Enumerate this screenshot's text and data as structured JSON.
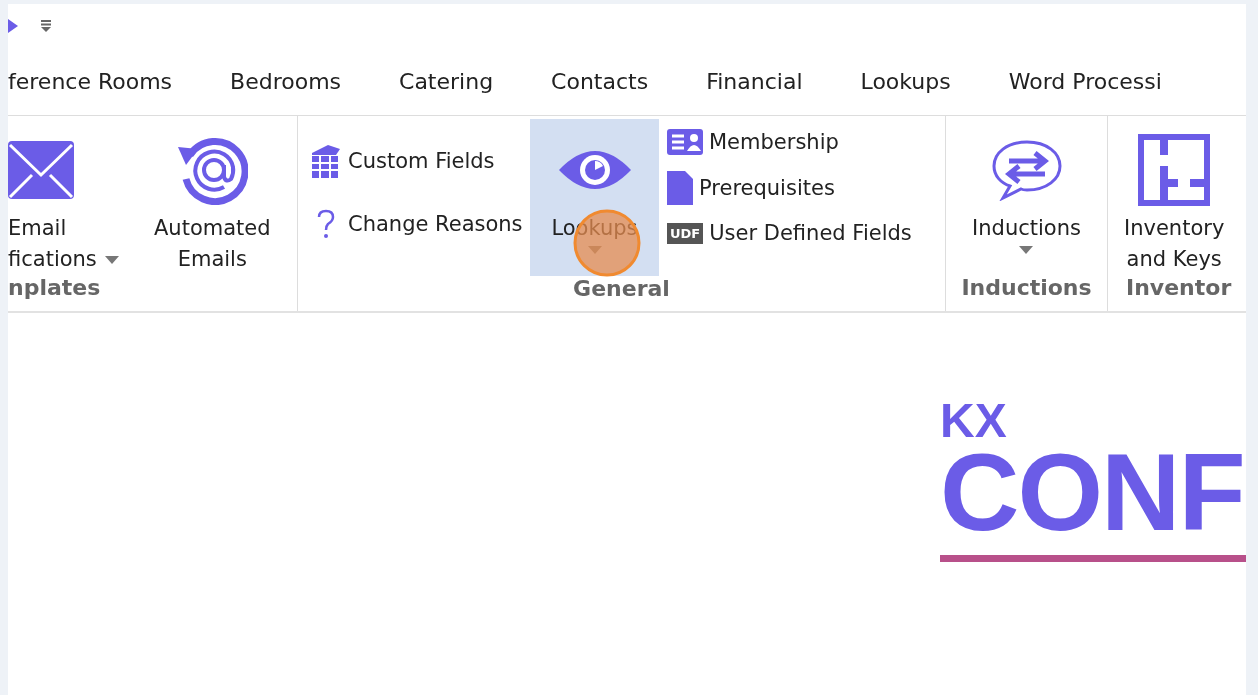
{
  "tabs": [
    {
      "label": "ference Rooms",
      "selected": false
    },
    {
      "label": "Bedrooms",
      "selected": false
    },
    {
      "label": "Catering",
      "selected": false
    },
    {
      "label": "Contacts",
      "selected": false
    },
    {
      "label": "Financial",
      "selected": false
    },
    {
      "label": "Lookups",
      "selected": false
    },
    {
      "label": "Word Processi",
      "selected": false
    }
  ],
  "ribbon": {
    "groups": [
      {
        "label": "nplates",
        "items": [
          {
            "kind": "large",
            "lines": [
              "Email",
              "fications"
            ],
            "dropdown": true,
            "selected": false
          },
          {
            "kind": "large",
            "lines": [
              "Automated",
              "Emails"
            ],
            "dropdown": false,
            "selected": false
          }
        ]
      },
      {
        "label": "General",
        "items": [
          {
            "kind": "stack",
            "buttons": [
              {
                "label": "Custom Fields"
              },
              {
                "label": "Change Reasons"
              }
            ]
          },
          {
            "kind": "large",
            "lines": [
              "Lookups"
            ],
            "dropdown": true,
            "selected": true
          },
          {
            "kind": "stack",
            "buttons": [
              {
                "label": "Membership"
              },
              {
                "label": "Prerequisites"
              },
              {
                "label": "User Defined Fields",
                "icon_text": "UDF"
              }
            ]
          }
        ]
      },
      {
        "label": "Inductions",
        "items": [
          {
            "kind": "large",
            "lines": [
              "Inductions"
            ],
            "dropdown": true,
            "selected": false
          }
        ]
      },
      {
        "label": "Inventor",
        "items": [
          {
            "kind": "large",
            "lines": [
              "Inventory",
              "and Keys"
            ],
            "dropdown": false,
            "selected": false
          }
        ]
      }
    ]
  },
  "logo": {
    "small": "KX",
    "large": "CONF"
  }
}
